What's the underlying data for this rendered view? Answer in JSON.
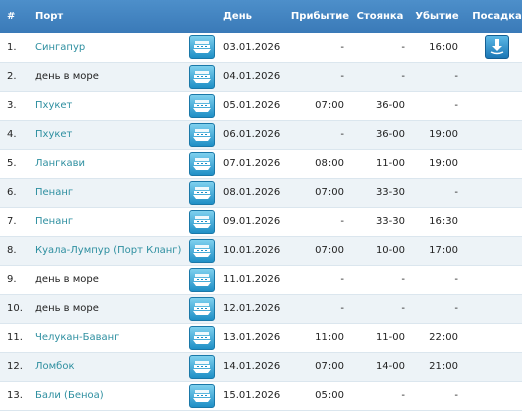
{
  "headers": {
    "num": "#",
    "port": "Порт",
    "day": "День",
    "arrival": "Прибытие",
    "stay": "Стоянка",
    "departure": "Убытие",
    "embark": "Посадка"
  },
  "icons": {
    "ship": "ship-icon",
    "embark": "embark-download-icon"
  },
  "colors": {
    "header_bg": "#3f80bf",
    "row_alt_bg": "#edf3f7",
    "port_link": "#2e8fa0"
  },
  "rows": [
    {
      "num": "1.",
      "port": "Сингапур",
      "is_link": true,
      "day": "03.01.2026",
      "arrival": "-",
      "stay": "-",
      "departure": "16:00",
      "embark": true
    },
    {
      "num": "2.",
      "port": "день в море",
      "is_link": false,
      "day": "04.01.2026",
      "arrival": "-",
      "stay": "-",
      "departure": "-",
      "embark": false
    },
    {
      "num": "3.",
      "port": "Пхукет",
      "is_link": true,
      "day": "05.01.2026",
      "arrival": "07:00",
      "stay": "36-00",
      "departure": "-",
      "embark": false
    },
    {
      "num": "4.",
      "port": "Пхукет",
      "is_link": true,
      "day": "06.01.2026",
      "arrival": "-",
      "stay": "36-00",
      "departure": "19:00",
      "embark": false
    },
    {
      "num": "5.",
      "port": "Лангкави",
      "is_link": true,
      "day": "07.01.2026",
      "arrival": "08:00",
      "stay": "11-00",
      "departure": "19:00",
      "embark": false
    },
    {
      "num": "6.",
      "port": "Пенанг",
      "is_link": true,
      "day": "08.01.2026",
      "arrival": "07:00",
      "stay": "33-30",
      "departure": "-",
      "embark": false
    },
    {
      "num": "7.",
      "port": "Пенанг",
      "is_link": true,
      "day": "09.01.2026",
      "arrival": "-",
      "stay": "33-30",
      "departure": "16:30",
      "embark": false
    },
    {
      "num": "8.",
      "port": "Куала-Лумпур (Порт Кланг)",
      "is_link": true,
      "day": "10.01.2026",
      "arrival": "07:00",
      "stay": "10-00",
      "departure": "17:00",
      "embark": false
    },
    {
      "num": "9.",
      "port": "день в море",
      "is_link": false,
      "day": "11.01.2026",
      "arrival": "-",
      "stay": "-",
      "departure": "-",
      "embark": false
    },
    {
      "num": "10.",
      "port": "день в море",
      "is_link": false,
      "day": "12.01.2026",
      "arrival": "-",
      "stay": "-",
      "departure": "-",
      "embark": false
    },
    {
      "num": "11.",
      "port": "Челукан-Баванг",
      "is_link": true,
      "day": "13.01.2026",
      "arrival": "11:00",
      "stay": "11-00",
      "departure": "22:00",
      "embark": false
    },
    {
      "num": "12.",
      "port": "Ломбок",
      "is_link": true,
      "day": "14.01.2026",
      "arrival": "07:00",
      "stay": "14-00",
      "departure": "21:00",
      "embark": false
    },
    {
      "num": "13.",
      "port": "Бали (Беноа)",
      "is_link": true,
      "day": "15.01.2026",
      "arrival": "05:00",
      "stay": "-",
      "departure": "-",
      "embark": false
    }
  ]
}
